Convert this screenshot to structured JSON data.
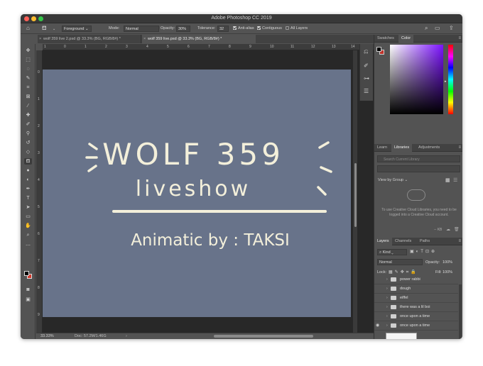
{
  "app": {
    "title": "Adobe Photoshop CC 2019"
  },
  "options_bar": {
    "fill_source": "Foreground",
    "mode_label": "Mode:",
    "mode_value": "Normal",
    "opacity_label": "Opacity:",
    "opacity_value": "30%",
    "tolerance_label": "Tolerance:",
    "tolerance_value": "32",
    "anti_alias": "Anti-alias",
    "contiguous": "Contiguous",
    "all_layers": "All Layers"
  },
  "tabs": [
    {
      "label": "wolf 359 live 2.psd @ 33.3% (BG, RGB/8#) *",
      "active": false
    },
    {
      "label": "wolf 359 live.psd @ 33.3% (BG, RGB/8#) *",
      "active": true
    }
  ],
  "ruler_numbers": [
    "1",
    "0",
    "1",
    "2",
    "3",
    "4",
    "5",
    "6",
    "7",
    "8",
    "9",
    "10",
    "11",
    "12",
    "13",
    "14"
  ],
  "ruler_numbers_v": [
    "0",
    "1",
    "2",
    "3",
    "4",
    "5",
    "6",
    "7",
    "8",
    "9"
  ],
  "artwork": {
    "title": "WOLF 359",
    "subtitle": "liveshow",
    "credit": "Animatic by : TAKSI",
    "background": "#68738a",
    "ink": "#f3efda"
  },
  "status": {
    "zoom": "33.33%",
    "doc": "Doc: 57.2M/1.46G"
  },
  "color_panel": {
    "tabs": [
      "Swatches",
      "Color"
    ],
    "active_tab": "Color"
  },
  "libraries_panel": {
    "tabs": [
      "Learn",
      "Libraries",
      "Adjustments"
    ],
    "active_tab": "Libraries",
    "search_placeholder": "Search Current Library",
    "view_by": "View by Group",
    "message": "To use Creative Cloud Libraries, you need to be logged into a Creative Cloud account.",
    "size": "-- KB"
  },
  "layers_panel": {
    "tabs": [
      "Layers",
      "Channels",
      "Paths"
    ],
    "active_tab": "Layers",
    "kind": "Kind",
    "blend_mode": "Normal",
    "opacity_label": "Opacity:",
    "opacity_value": "100%",
    "lock_label": "Lock:",
    "fill_label": "Fill:",
    "fill_value": "100%",
    "layers": [
      {
        "name": "power rabbi",
        "visible": false
      },
      {
        "name": "dough",
        "visible": false
      },
      {
        "name": "eiffel",
        "visible": false
      },
      {
        "name": "there was a lil boi",
        "visible": false
      },
      {
        "name": "once upon a time",
        "visible": false
      },
      {
        "name": "once upon a time",
        "visible": true
      }
    ]
  }
}
